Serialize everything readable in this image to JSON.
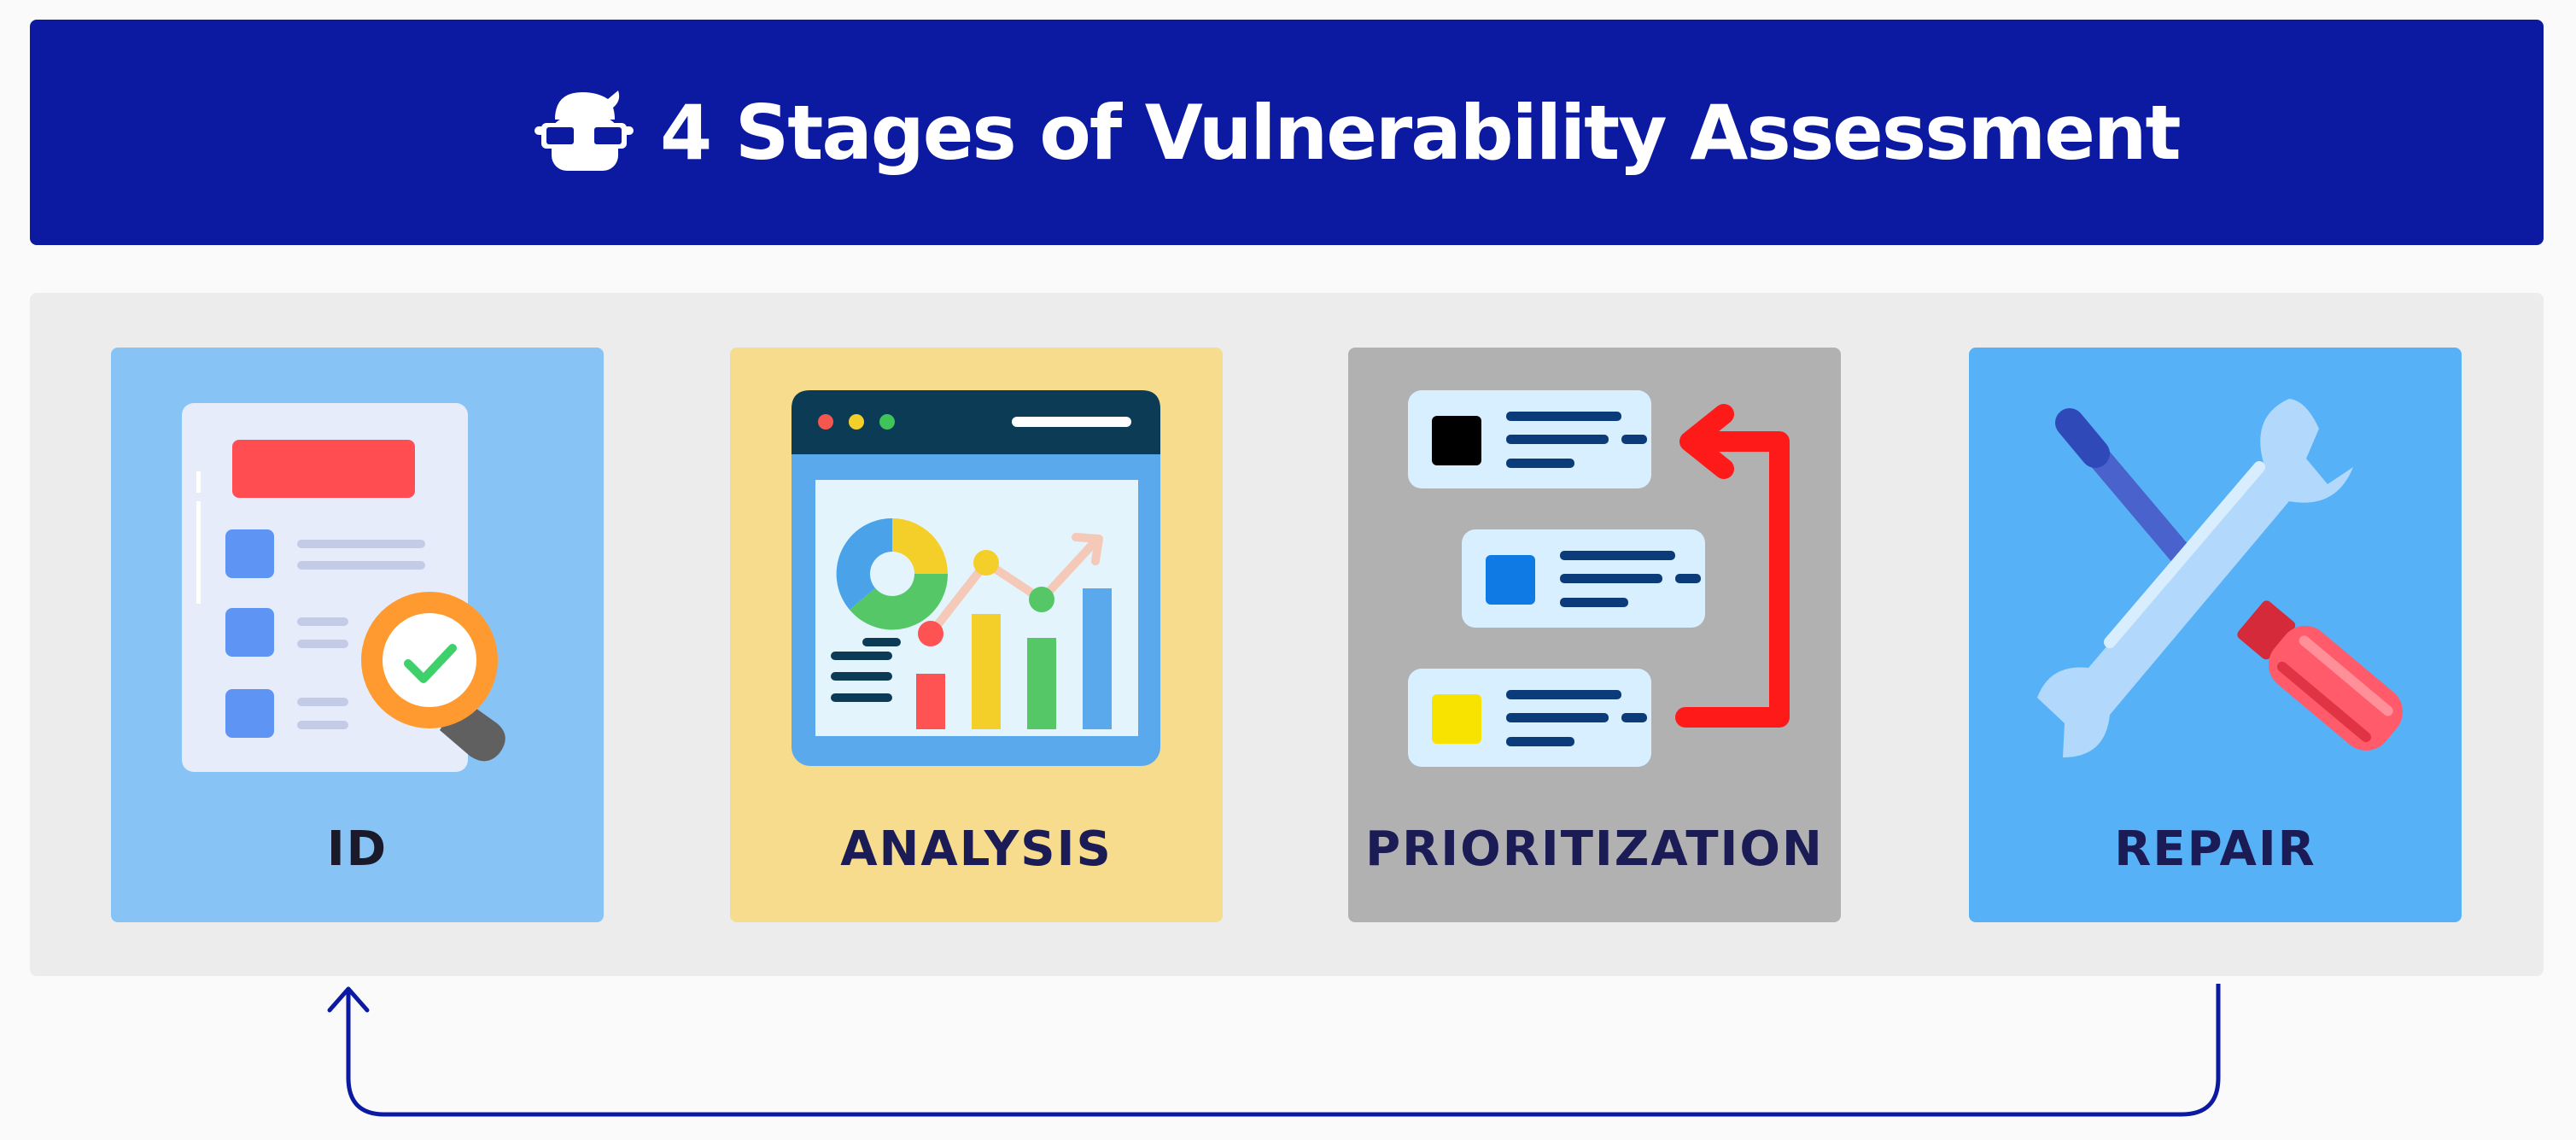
{
  "header": {
    "title": "4 Stages of Vulnerability Assessment",
    "logo_icon": "nerd-mascot-icon",
    "background": "#0b1aa0"
  },
  "stages": [
    {
      "label": "ID",
      "icon": "checklist-magnifier-icon",
      "color": "#87c4f5"
    },
    {
      "label": "ANALYSIS",
      "icon": "analytics-dashboard-icon",
      "color": "#f6dc8c"
    },
    {
      "label": "PRIORITIZATION",
      "icon": "priority-list-icon",
      "color": "#b1b1b1"
    },
    {
      "label": "REPAIR",
      "icon": "wrench-screwdriver-icon",
      "color": "#56b1f7"
    }
  ],
  "loop_arrow": {
    "from": "REPAIR",
    "to": "ID",
    "color": "#0b1aa0"
  }
}
